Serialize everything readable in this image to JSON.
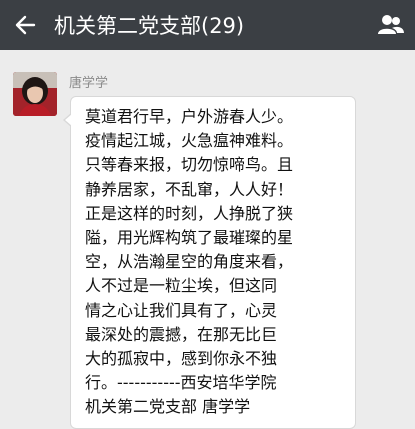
{
  "header": {
    "title": "机关第二党支部(29)",
    "back_icon": "back-arrow-icon",
    "members_icon": "group-members-icon"
  },
  "message": {
    "sender": "唐学学",
    "lines": [
      "莫道君行早，户外游春人少。",
      "疫情起江城，火急瘟神难料。",
      "只等春来报，切勿惊啼鸟。且",
      "静养居家，不乱窜，人人好！",
      "正是这样的时刻，人挣脱了狭",
      "隘，用光辉构筑了最璀璨的星",
      "空，从浩瀚星空的角度来看，",
      "人不过是一粒尘埃，但这同",
      "情之心让我们具有了，心灵",
      "最深处的震撼，在那无比巨",
      "大的孤寂中，感到你永不独",
      "行。-----------西安培华学院",
      "机关第二党支部 唐学学"
    ]
  },
  "colors": {
    "header_bg": "#3b3f44",
    "chat_bg": "#ececec",
    "bubble_bg": "#ffffff"
  }
}
